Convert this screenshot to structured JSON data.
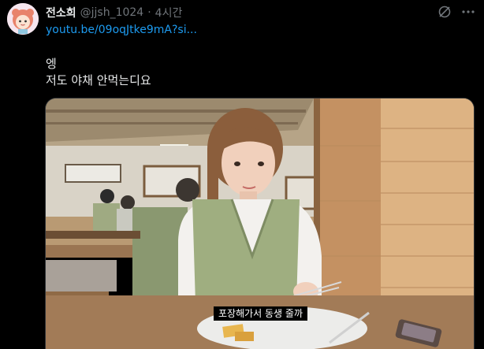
{
  "user": {
    "display_name": "전소희",
    "handle": "@jjsh_1024",
    "separator": "·",
    "time": "4시간"
  },
  "icons": {
    "avatar": "cartoon-avatar",
    "grok": "grok-icon",
    "more": "more-icon"
  },
  "tweet": {
    "link": "youtu.be/09oqJtke9mA?si...",
    "lines": [
      "엥",
      "저도 야채 안먹는디요"
    ]
  },
  "media": {
    "subtitle": "포장해가서 동생 줄까"
  },
  "colors": {
    "link": "#1d9bf0",
    "muted": "#71767b",
    "text": "#e7e9ea",
    "background": "#000000"
  }
}
